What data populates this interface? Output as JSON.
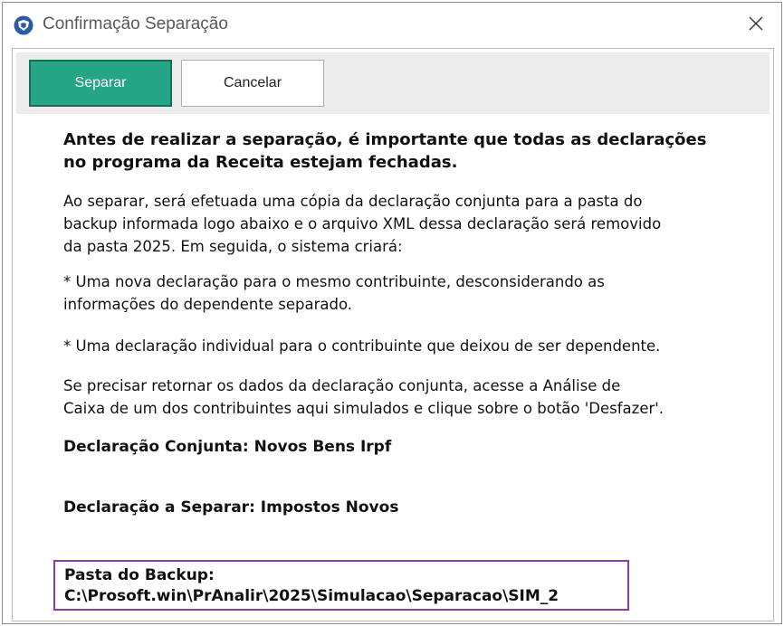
{
  "window": {
    "title": "Confirmação Separação",
    "icon": "shield-logo-icon",
    "close_icon": "close-icon"
  },
  "toolbar": {
    "separar_label": "Separar",
    "cancelar_label": "Cancelar"
  },
  "colors": {
    "primary_button": "#26a586",
    "highlight_border": "#8b3aa6"
  },
  "message": {
    "heading_line1": "Antes de realizar a separação, é importante que todas as declarações",
    "heading_line2": "no programa da Receita estejam fechadas.",
    "p1_line1": "Ao separar, será efetuada uma cópia da declaração conjunta para a pasta do",
    "p1_line2": "backup informada logo abaixo e o arquivo XML dessa declaração será removido",
    "p1_line3": "da pasta 2025. Em seguida, o sistema criará:",
    "p2_line1": "* Uma nova declaração para o mesmo contribuinte, desconsiderando as",
    "p2_line2": "informações do dependente separado.",
    "p3_line1": "* Uma declaração individual para o contribuinte que deixou de ser dependente.",
    "p4_line1": "Se precisar retornar os dados da declaração conjunta, acesse a Análise de",
    "p4_line2": "Caixa de um dos contribuintes aqui simulados e clique sobre o botão 'Desfazer'."
  },
  "fields": {
    "conjunta_label": "Declaração Conjunta:",
    "conjunta_value": "Novos Bens Irpf",
    "separar_label": "Declaração a Separar:",
    "separar_value": "Impostos Novos",
    "backup_label": "Pasta do Backup:",
    "backup_value": "C:\\Prosoft.win\\PrAnalir\\2025\\Simulacao\\Separacao\\SIM_2"
  }
}
